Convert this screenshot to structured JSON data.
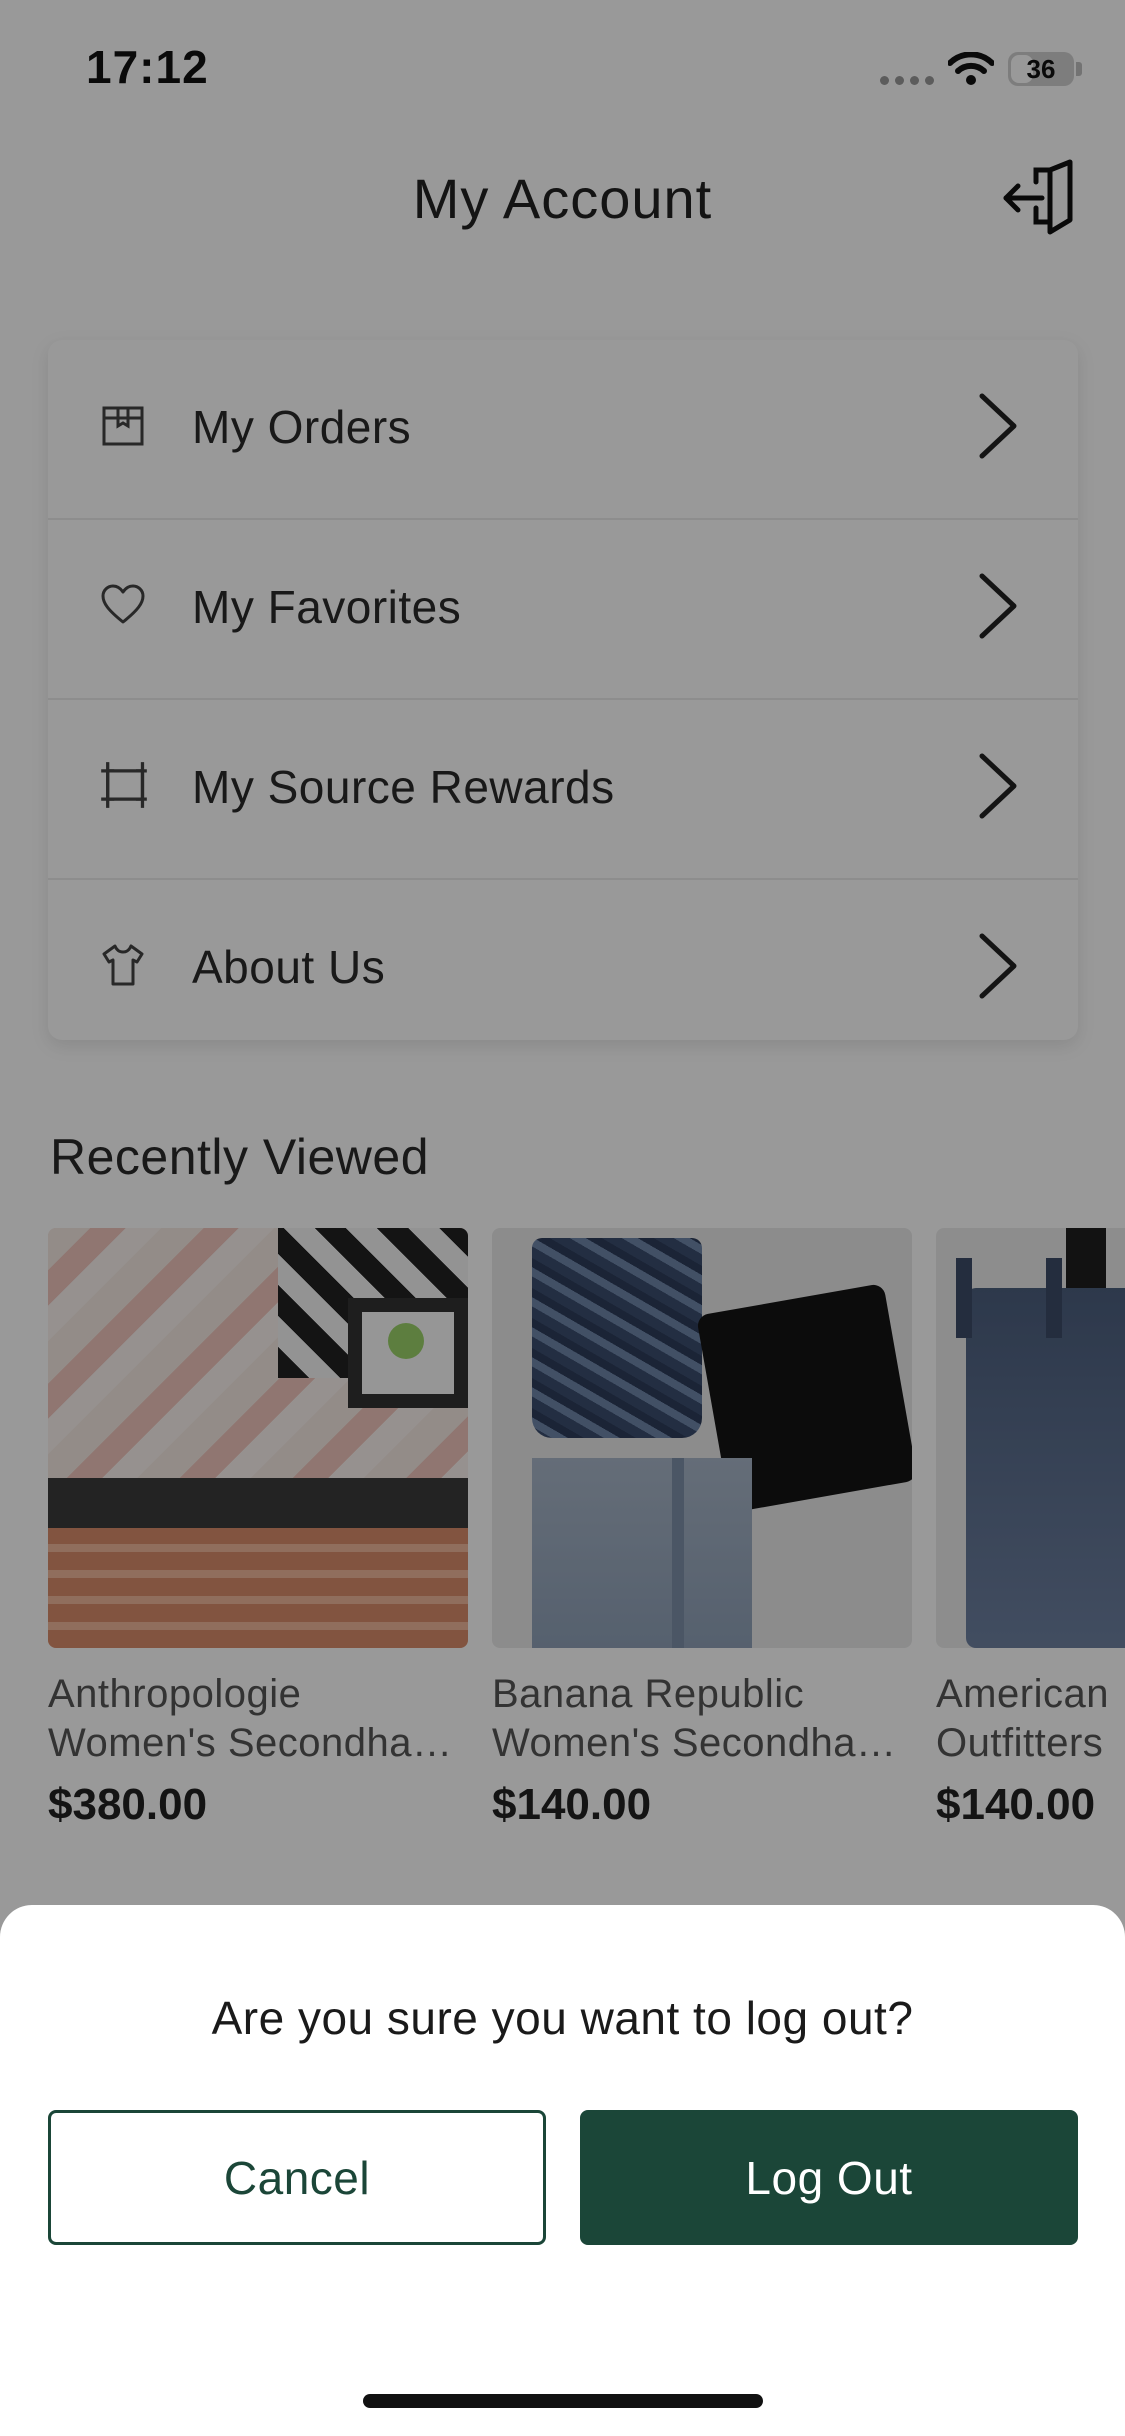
{
  "status_bar": {
    "time": "17:12",
    "battery_level": "36",
    "battery_fraction": 0.36
  },
  "header": {
    "title": "My Account",
    "logout_icon": "logout-icon"
  },
  "menu": {
    "items": [
      {
        "label": "My Orders",
        "icon": "box-icon"
      },
      {
        "label": "My Favorites",
        "icon": "heart-icon"
      },
      {
        "label": "My Source Rewards",
        "icon": "ticket-icon"
      },
      {
        "label": "About Us",
        "icon": "tshirt-icon"
      }
    ]
  },
  "recently_viewed": {
    "title": "Recently Viewed",
    "products": [
      {
        "brand": "Anthropologie",
        "name": "Women's Secondha…",
        "price": "$380.00"
      },
      {
        "brand": "Banana Republic",
        "name": "Women's Secondha…",
        "price": "$140.00"
      },
      {
        "brand": "American",
        "name": "Outfitters",
        "price": "$140.00"
      }
    ]
  },
  "dialog": {
    "message": "Are you sure you want to log out?",
    "cancel_label": "Cancel",
    "logout_label": "Log Out"
  },
  "colors": {
    "brand_green": "#1b4638",
    "overlay": "rgba(0,0,0,0.40)"
  }
}
